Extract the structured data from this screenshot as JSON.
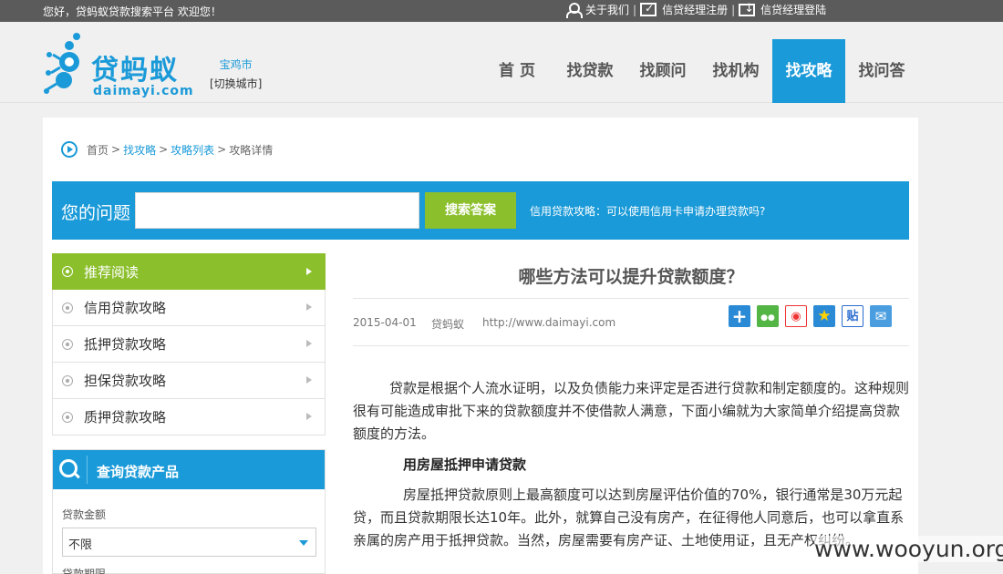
{
  "topbar": {
    "welcome": "您好，贷蚂蚁贷款搜索平台 欢迎您！",
    "links": [
      {
        "label": "关于我们",
        "icon": "user-icon"
      },
      {
        "label": "信贷经理注册",
        "icon": "register-icon"
      },
      {
        "label": "信贷经理登陆",
        "icon": "login-icon"
      }
    ],
    "separator": "|"
  },
  "logo": {
    "cn": "贷蚂蚁",
    "en": "daimayi.com"
  },
  "city": {
    "name": "宝鸡市",
    "switch_label": "[切换城市]"
  },
  "nav": [
    {
      "label": "首 页",
      "active": false
    },
    {
      "label": "找贷款",
      "active": false
    },
    {
      "label": "找顾问",
      "active": false
    },
    {
      "label": "找机构",
      "active": false
    },
    {
      "label": "找攻略",
      "active": true
    },
    {
      "label": "找问答",
      "active": false
    }
  ],
  "breadcrumb": {
    "home": "首页",
    "sep": ">",
    "l1": "找攻略",
    "l2": "攻略列表",
    "current": "攻略详情"
  },
  "search": {
    "label": "您的问题",
    "placeholder": "",
    "button": "搜索答案",
    "hint": "信用贷款攻略：可以使用信用卡申请办理贷款吗?"
  },
  "sidebar": {
    "items": [
      {
        "label": "推荐阅读",
        "active": true
      },
      {
        "label": "信用贷款攻略",
        "active": false
      },
      {
        "label": "抵押贷款攻略",
        "active": false
      },
      {
        "label": "担保贷款攻略",
        "active": false
      },
      {
        "label": "质押贷款攻略",
        "active": false
      }
    ]
  },
  "query": {
    "title": "查询贷款产品",
    "amount_label": "贷款金额",
    "amount_value": "不限",
    "term_label": "贷款期限"
  },
  "article": {
    "title": "哪些方法可以提升贷款额度？",
    "date": "2015-04-01",
    "author": "贷蚂蚁",
    "url": "http://www.daimayi.com",
    "share_icons": [
      "plus-share-icon",
      "wechat-icon",
      "weibo-icon",
      "qzone-icon",
      "tieba-icon",
      "mail-icon"
    ],
    "para1": "贷款是根据个人流水证明，以及负债能力来评定是否进行贷款和制定额度的。这种规则很有可能造成审批下来的贷款额度并不使借款人满意，下面小编就为大家简单介绍提高贷款额度的方法。",
    "subheading": "用房屋抵押申请贷款",
    "para2": "房屋抵押贷款原则上最高额度可以达到房屋评估价值的70%，银行通常是30万元起贷，而且贷款期限长达10年。此外，就算自己没有房产，在征得他人同意后，也可以拿直系亲属的房产用于抵押贷款。当然，房屋需要有房产证、土地使用证，且无产权纠纷。"
  },
  "watermark": "www.wooyun.org"
}
